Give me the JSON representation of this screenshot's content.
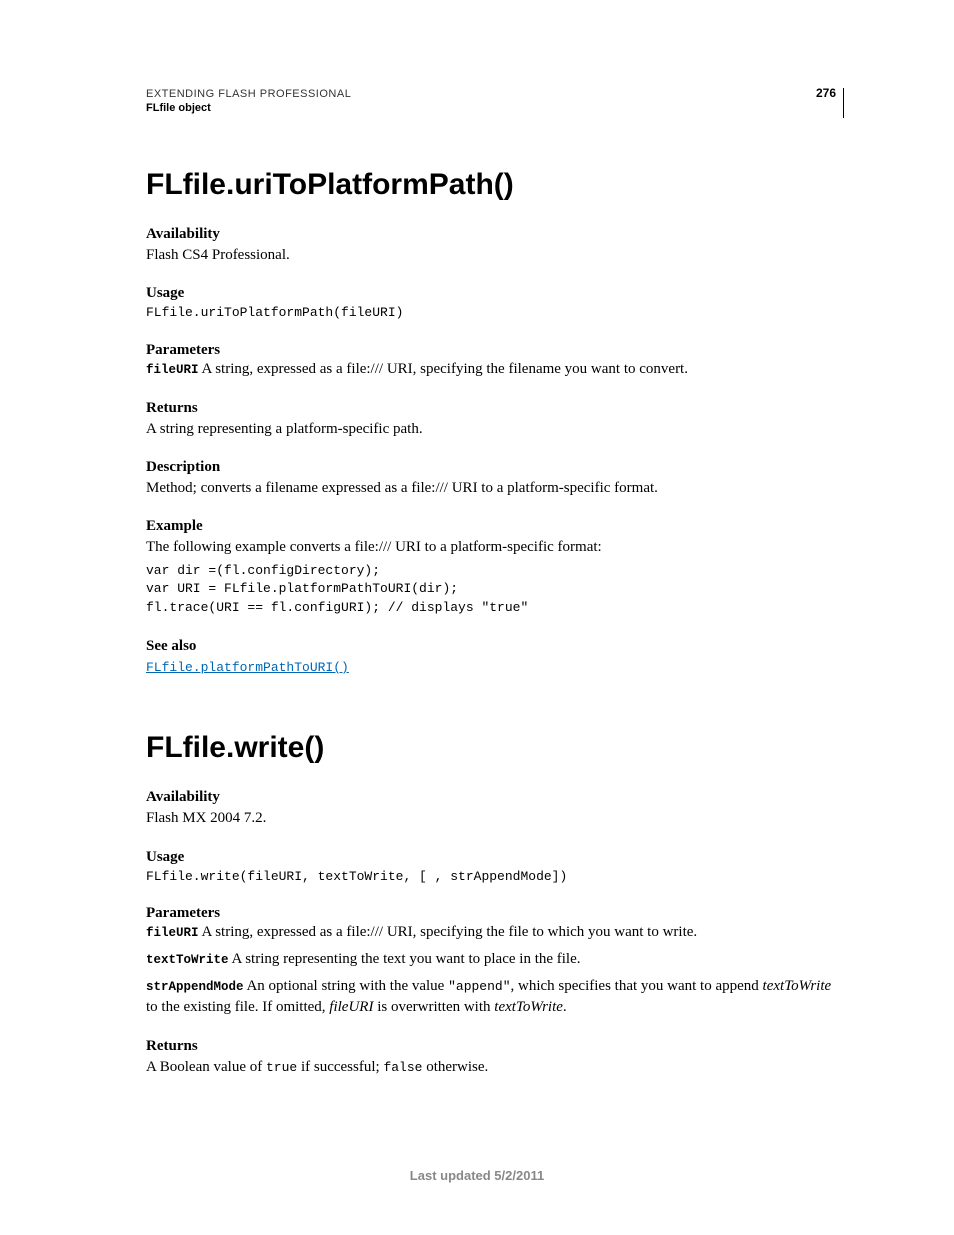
{
  "header": {
    "top": "EXTENDING FLASH PROFESSIONAL",
    "sub": "FLfile object",
    "page": "276"
  },
  "s1": {
    "title": "FLfile.uriToPlatformPath()",
    "avail_h": "Availability",
    "avail": "Flash CS4 Professional.",
    "usage_h": "Usage",
    "usage": "FLfile.uriToPlatformPath(fileURI)",
    "params_h": "Parameters",
    "p1_name": "fileURI",
    "p1_desc": "  A string, expressed as a file:/// URI, specifying the filename you want to convert.",
    "returns_h": "Returns",
    "returns": "A string representing a platform-specific path.",
    "desc_h": "Description",
    "desc": "Method; converts a filename expressed as a file:/// URI to a platform-specific format.",
    "ex_h": "Example",
    "ex_intro": "The following example converts a file:/// URI to a platform-specific format:",
    "ex_code": "var dir =(fl.configDirectory); \nvar URI = FLfile.platformPathToURI(dir); \nfl.trace(URI == fl.configURI); // displays \"true\"",
    "seealso_h": "See also",
    "seealso_link": "FLfile.platformPathToURI()"
  },
  "s2": {
    "title": "FLfile.write()",
    "avail_h": "Availability",
    "avail": "Flash MX 2004 7.2.",
    "usage_h": "Usage",
    "usage": "FLfile.write(fileURI, textToWrite, [ , strAppendMode])",
    "params_h": "Parameters",
    "p1_name": "fileURI",
    "p1_desc": "  A string, expressed as a file:/// URI, specifying the file to which you want to write.",
    "p2_name": "textToWrite",
    "p2_desc": "  A string representing the text you want to place in the file.",
    "p3_name": "strAppendMode",
    "p3_pre": "  An optional string with the value ",
    "p3_code": "\"append\"",
    "p3_mid": ", which specifies that you want to append ",
    "p3_it1": "textToWrite",
    "p3_post": " to the existing file. If omitted, ",
    "p3_it2": "fileURI",
    "p3_post2": " is overwritten with ",
    "p3_it3": "textToWrite",
    "p3_end": ".",
    "returns_h": "Returns",
    "ret_pre": "A Boolean value of ",
    "ret_c1": "true",
    "ret_mid": " if successful; ",
    "ret_c2": "false",
    "ret_post": " otherwise."
  },
  "footer": "Last updated 5/2/2011"
}
